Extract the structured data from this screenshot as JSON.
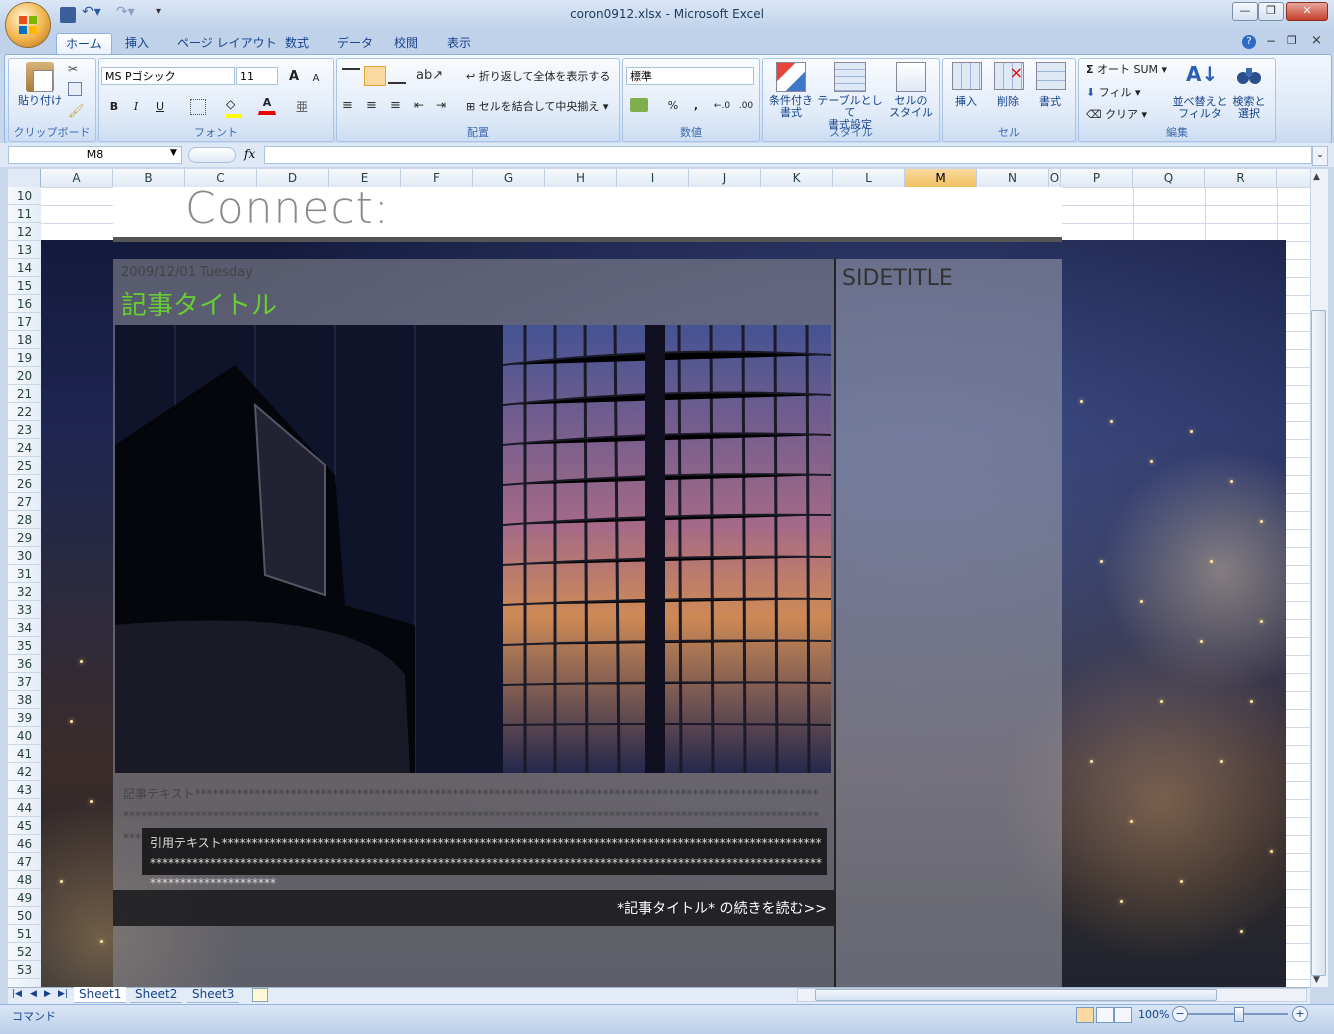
{
  "window": {
    "title": "coron0912.xlsx - Microsoft Excel",
    "minimize": "—",
    "restore": "❐",
    "close": "✕"
  },
  "ribbon_tabs": [
    "ホーム",
    "挿入",
    "ページ レイアウト",
    "数式",
    "データ",
    "校閲",
    "表示"
  ],
  "ribbon_right": {
    "help": "?",
    "minimize": "−",
    "restore": "❐",
    "close": "×"
  },
  "groups": {
    "clipboard": {
      "label": "クリップボード",
      "paste": "貼り付け"
    },
    "font": {
      "label": "フォント",
      "font_name": "MS Pゴシック",
      "font_size": "11",
      "bold": "B",
      "italic": "I",
      "underline": "U",
      "grow": "A",
      "shrink": "A",
      "font_color": "A"
    },
    "alignment": {
      "label": "配置",
      "wrap_text": "折り返して全体を表示する",
      "merge_center": "セルを結合して中央揃え"
    },
    "number": {
      "label": "数値",
      "format": "標準",
      "percent": "%",
      "comma": ",",
      "inc_decimal": "←.0",
      "dec_decimal": ".00"
    },
    "styles": {
      "label": "スタイル",
      "conditional": [
        "条件付き",
        "書式"
      ],
      "table": [
        "テーブルとして",
        "書式設定"
      ],
      "cell_styles": [
        "セルの",
        "スタイル"
      ]
    },
    "cells": {
      "label": "セル",
      "insert": "挿入",
      "delete": "削除",
      "format": "書式"
    },
    "editing": {
      "label": "編集",
      "autosum": "オート SUM",
      "fill": "フィル",
      "clear": "クリア",
      "sort": [
        "並べ替えと",
        "フィルタ"
      ],
      "find": [
        "検索と",
        "選択"
      ]
    }
  },
  "formula_bar": {
    "name_box": "M8",
    "fx": "fx",
    "value": ""
  },
  "columns": [
    "A",
    "B",
    "C",
    "D",
    "E",
    "F",
    "G",
    "H",
    "I",
    "J",
    "K",
    "L",
    "M",
    "N",
    "O",
    "P",
    "Q",
    "R"
  ],
  "selected_column": "M",
  "rows": [
    "10",
    "11",
    "12",
    "13",
    "14",
    "15",
    "16",
    "17",
    "18",
    "19",
    "20",
    "21",
    "22",
    "23",
    "24",
    "25",
    "26",
    "27",
    "28",
    "29",
    "30",
    "31",
    "32",
    "33",
    "34",
    "35",
    "36",
    "37",
    "38",
    "39",
    "40",
    "41",
    "42",
    "43",
    "44",
    "45",
    "46",
    "47",
    "48",
    "49",
    "50",
    "51",
    "52",
    "53"
  ],
  "page": {
    "logo": "Connect:",
    "post_date": "2009/12/01 Tuesday",
    "post_title": "記事タイトル",
    "side_title": "SIDETITLE",
    "post_text": "記事テキスト*****************************************************************************************************************************************************************************************************************************************************",
    "quote_text": "引用テキスト*****************************************************************************************************************************************************************************************************************************************",
    "read_more": "*記事タイトル* の続きを読む>>"
  },
  "sheets": [
    "Sheet1",
    "Sheet2",
    "Sheet3"
  ],
  "active_sheet": "Sheet1",
  "status": {
    "mode": "コマンド",
    "zoom": "100%",
    "zoom_out": "−",
    "zoom_in": "+"
  },
  "colors": {
    "title_green": "#66cc33",
    "selected_header": "#f1c15f",
    "ribbon_text": "#15428b"
  }
}
